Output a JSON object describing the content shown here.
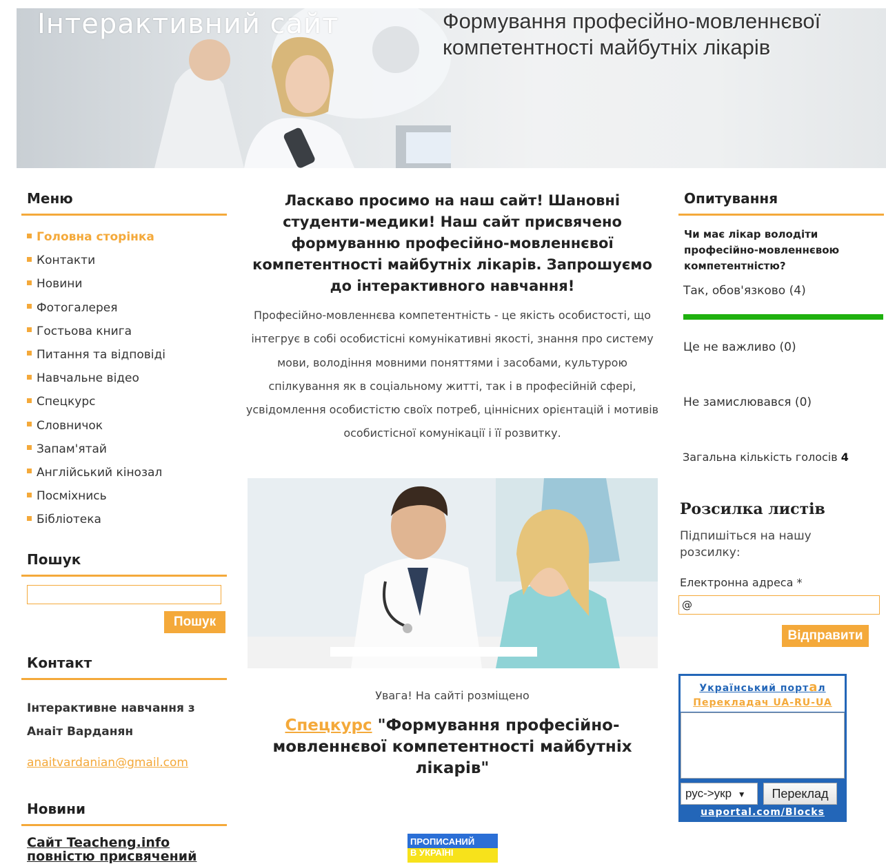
{
  "header": {
    "site_title": "Інтерактивний сайт",
    "slogan": "Формування професійно-мовленнєвої компетентності майбутніх лікарів"
  },
  "menu": {
    "title": "Меню",
    "items": [
      {
        "label": "Головна сторінка",
        "active": true
      },
      {
        "label": "Контакти"
      },
      {
        "label": "Новини"
      },
      {
        "label": "Фотогалерея"
      },
      {
        "label": "Гостьова книга"
      },
      {
        "label": "Питання та відповіді"
      },
      {
        "label": "Навчальне відео"
      },
      {
        "label": "Спецкурс"
      },
      {
        "label": "Словничок"
      },
      {
        "label": "Запам'ятай"
      },
      {
        "label": "Англійський кінозал"
      },
      {
        "label": "Посміхнись"
      },
      {
        "label": "Бібліотека"
      }
    ]
  },
  "search": {
    "title": "Пошук",
    "input_value": "",
    "button": "Пошук"
  },
  "contact": {
    "title": "Контакт",
    "text": "Інтерактивне навчання з Анаіт Варданян",
    "email": "anaitvardanian@gmail.com"
  },
  "news": {
    "title": "Новини",
    "link": "Сайт Teacheng.info повністю присвячений"
  },
  "main": {
    "welcome": "Ласкаво просимо на наш сайт! Шановні студенти-медики! Наш сайт присвячено формуванню професійно-мовленнєвої компетентності майбутніх лікарів. Запрошуємо до інтерактивного навчання!",
    "intro": "Професійно-мовленнєва компетентність - це якість особистості, що інтегрує в собі особистісні комунікативні якості, знання про систему мови, володіння мовними поняттями і засобами, культурою спілкування як в соціальному житті, так і в професійній сфері, усвідомлення особистістю своїх потреб, ціннісних орієнтацій і мотивів особистісної комунікації і її розвитку.",
    "notice": "Увага! На сайті розміщено",
    "course_link": "Спецкурс",
    "course_title": "\"Формування професійно-мовленнєвої компетентності майбутніх лікарів\"",
    "badge_line1": "ПРОПИСАНИЙ",
    "badge_line2": "В УКРАЇНІ"
  },
  "poll": {
    "title": "Опитування",
    "question": "Чи має лікар володіти професійно-мовленнєвою компетентністю?",
    "options": [
      {
        "label": "Так, обов'язково (4)",
        "votes": 4,
        "share": 1.0
      },
      {
        "label": "Це не важливо (0)",
        "votes": 0,
        "share": 0
      },
      {
        "label": "Не замислювався (0)",
        "votes": 0,
        "share": 0
      }
    ],
    "total_label": "Загальна кількість голосів",
    "total": "4",
    "bar_color": "#1fb10f"
  },
  "newsletter": {
    "title": "Розсилка листів",
    "description": "Підпишіться на нашу розсилку:",
    "email_label": "Електронна адреса *",
    "email_value": "@",
    "button": "Відправити"
  },
  "translator": {
    "title_part1": "Український порт",
    "title_accent": "а",
    "title_part2": "л",
    "subtitle": "Перекладач UA-RU-UA",
    "direction": "рус->укр",
    "button": "Переклад",
    "footer": "uaportal.com/Blocks"
  },
  "colors": {
    "accent": "#f4a93a",
    "poll_bar": "#1fb10f",
    "translator_blue": "#2366b8"
  }
}
